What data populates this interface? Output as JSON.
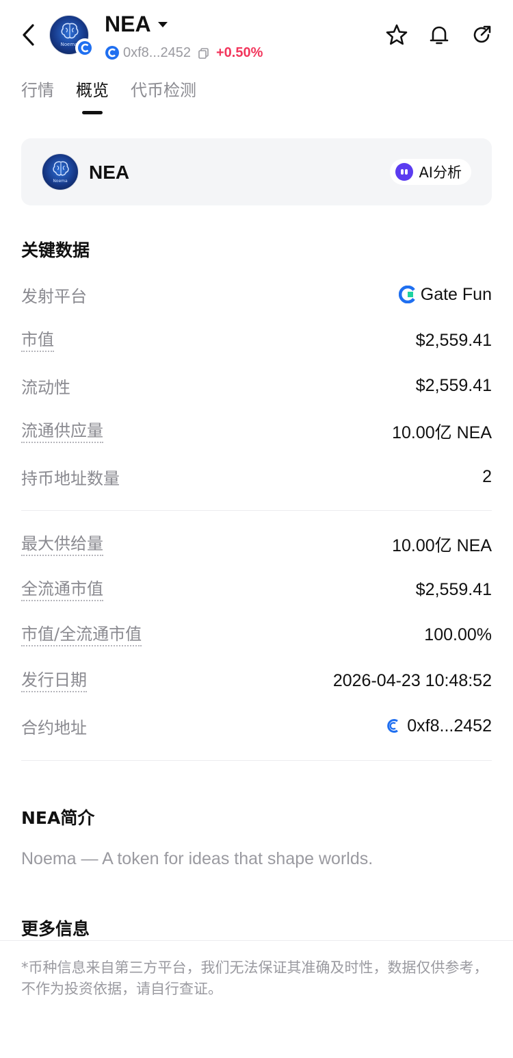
{
  "header": {
    "title": "NEA",
    "address": "0xf8...2452",
    "change": "+0.50%",
    "avatar_text": "Noema"
  },
  "tabs": [
    {
      "label": "行情"
    },
    {
      "label": "概览"
    },
    {
      "label": "代币检测"
    }
  ],
  "card": {
    "name": "NEA",
    "ai_label": "AI分析"
  },
  "key_data": {
    "title": "关键数据",
    "platform_label": "发射平台",
    "platform_value": "Gate Fun",
    "market_cap_label": "市值",
    "market_cap_value": "$2,559.41",
    "liquidity_label": "流动性",
    "liquidity_value": "$2,559.41",
    "circulating_label": "流通供应量",
    "circulating_value": "10.00亿 NEA",
    "holders_label": "持币地址数量",
    "holders_value": "2",
    "max_supply_label": "最大供给量",
    "max_supply_value": "10.00亿 NEA",
    "fdv_label": "全流通市值",
    "fdv_value": "$2,559.41",
    "ratio_label": "市值/全流通市值",
    "ratio_value": "100.00%",
    "issue_date_label": "发行日期",
    "issue_date_value": "2026-04-23 10:48:52",
    "contract_label": "合约地址",
    "contract_value": "0xf8...2452"
  },
  "intro": {
    "title": "NEA简介",
    "text": "Noema — A token for ideas that shape worlds."
  },
  "more_info": {
    "title": "更多信息"
  },
  "disclaimer": "*币种信息来自第三方平台，我们无法保证其准确及时性，数据仅供参考，不作为投资依据，请自行查证。",
  "colors": {
    "positive": "#f2365c",
    "label_gray": "#8a8a90",
    "card_bg": "#f4f5f7",
    "ai_purple": "#5b3cf0",
    "gate_blue": "#1f6ff0",
    "gate_green": "#1ed3a0"
  }
}
